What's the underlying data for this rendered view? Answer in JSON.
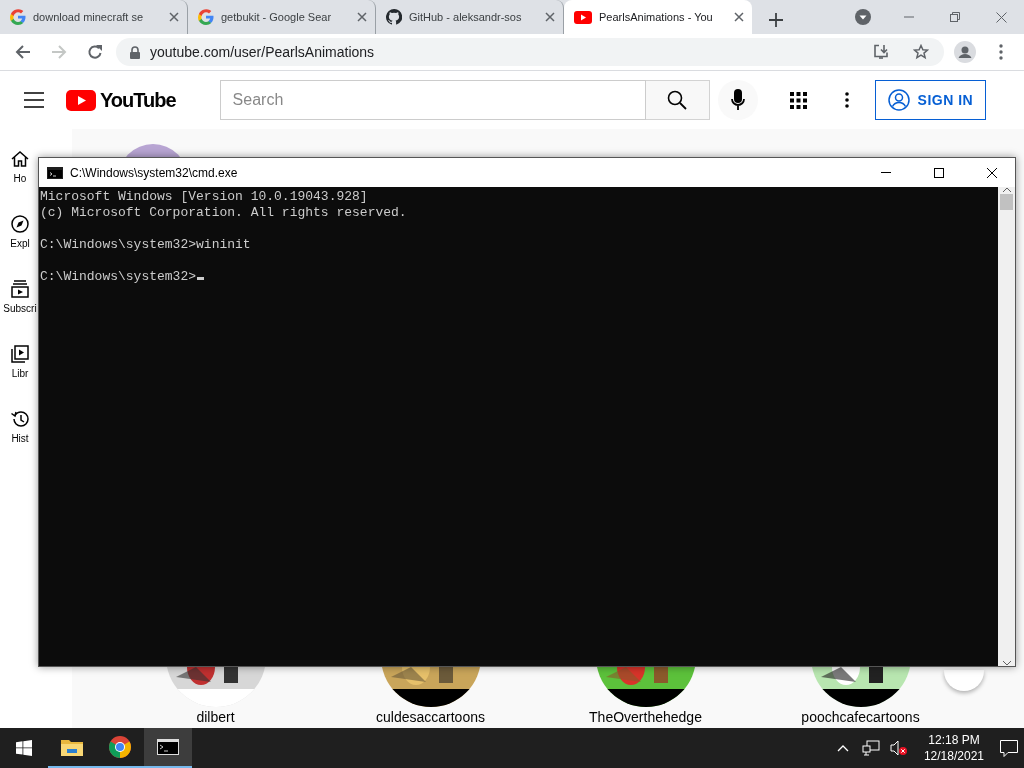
{
  "browser": {
    "tabs": [
      {
        "title": "download minecraft se",
        "kind": "google",
        "selected": false
      },
      {
        "title": "getbukit - Google Sear",
        "kind": "google",
        "selected": false
      },
      {
        "title": "GitHub - aleksandr-sos",
        "kind": "github",
        "selected": false
      },
      {
        "title": "PearlsAnimations - You",
        "kind": "youtube",
        "selected": true
      }
    ],
    "forward_disabled": true,
    "url": "youtube.com/user/PearlsAnimations"
  },
  "youtube": {
    "logo": "YouTube",
    "search": {
      "placeholder": "Search"
    },
    "sign_in": "SIGN IN",
    "sidebar": [
      {
        "label": "Ho",
        "kind": "home"
      },
      {
        "label": "Expl",
        "kind": "explore"
      },
      {
        "label": "Subscri",
        "kind": "subscriptions"
      },
      {
        "label": "Libr",
        "kind": "library"
      },
      {
        "label": "Hist",
        "kind": "history"
      }
    ],
    "channels": [
      {
        "name": "dilbert"
      },
      {
        "name": "culdesaccartoons"
      },
      {
        "name": "TheOverthehedge"
      },
      {
        "name": "poochcafecartoons"
      }
    ]
  },
  "cmd": {
    "title": "C:\\Windows\\system32\\cmd.exe",
    "paragraphs": [
      [
        "Microsoft Windows [Version 10.0.19043.928]",
        "(c) Microsoft Corporation. All rights reserved."
      ],
      [
        "C:\\Windows\\system32>wininit"
      ],
      [
        "C:\\Windows\\system32>"
      ]
    ],
    "cursor": true
  },
  "taskbar": {
    "apps": [
      {
        "kind": "explorer",
        "selected": false
      },
      {
        "kind": "chrome",
        "selected": false
      },
      {
        "kind": "cmd",
        "selected": true
      }
    ],
    "volume_muted": true,
    "time": "12:18 PM",
    "date": "12/18/2021"
  }
}
